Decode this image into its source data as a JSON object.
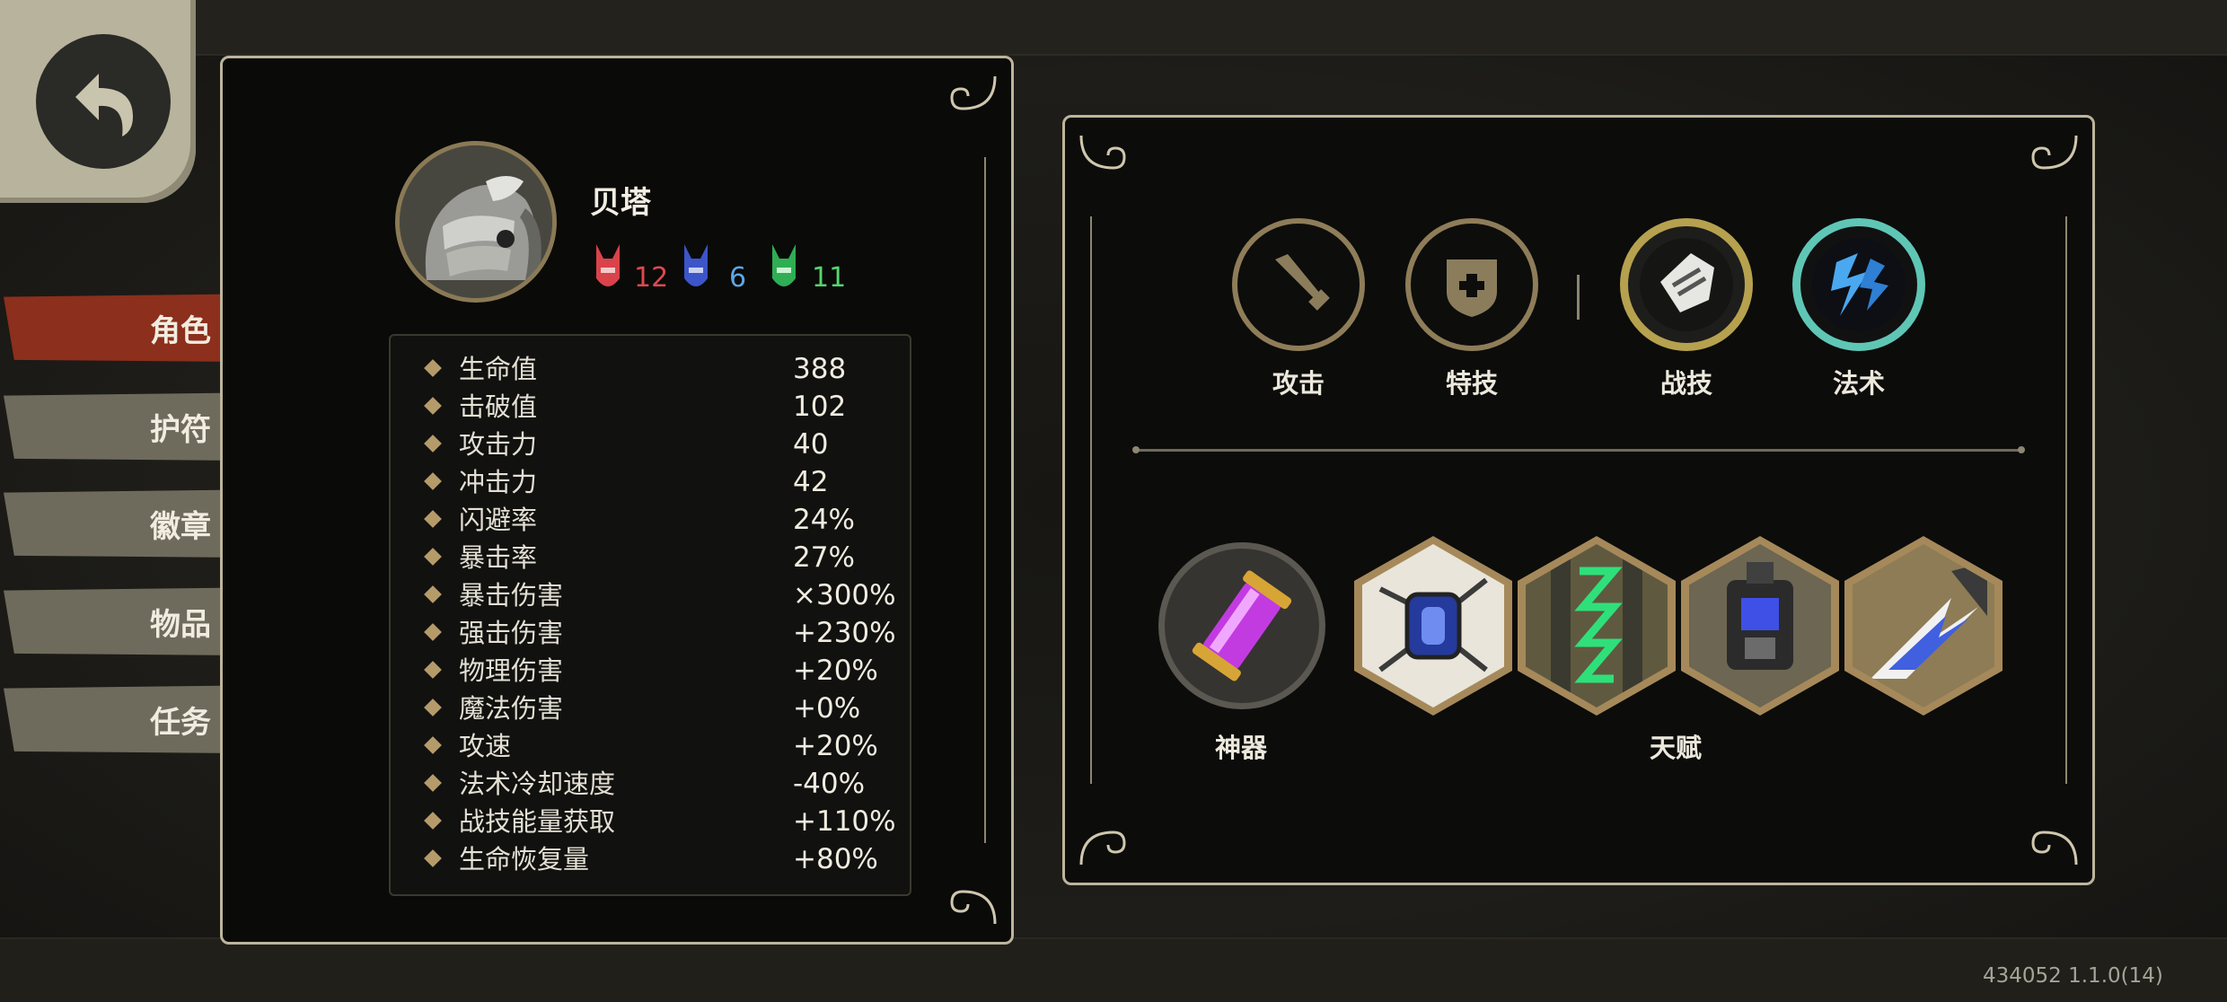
{
  "character": {
    "name": "贝塔",
    "resources": [
      {
        "icon": "red-mask-icon",
        "value": "12",
        "color": "#e0484d"
      },
      {
        "icon": "blue-mask-icon",
        "value": "6",
        "color": "#5fa6e6"
      },
      {
        "icon": "green-mask-icon",
        "value": "11",
        "color": "#55d66a"
      }
    ]
  },
  "tabs": [
    {
      "label": "角色",
      "active": true
    },
    {
      "label": "护符",
      "active": false
    },
    {
      "label": "徽章",
      "active": false
    },
    {
      "label": "物品",
      "active": false
    },
    {
      "label": "任务",
      "active": false
    }
  ],
  "stats": [
    {
      "label": "生命值",
      "value": "388"
    },
    {
      "label": "击破值",
      "value": "102"
    },
    {
      "label": "攻击力",
      "value": "40"
    },
    {
      "label": "冲击力",
      "value": "42"
    },
    {
      "label": "闪避率",
      "value": "24%"
    },
    {
      "label": "暴击率",
      "value": "27%"
    },
    {
      "label": "暴击伤害",
      "value": "×300%"
    },
    {
      "label": "强击伤害",
      "value": "+230%"
    },
    {
      "label": "物理伤害",
      "value": "+20%"
    },
    {
      "label": "魔法伤害",
      "value": "+0%"
    },
    {
      "label": "攻速",
      "value": "+20%"
    },
    {
      "label": "法术冷却速度",
      "value": "-40%"
    },
    {
      "label": "战技能量获取",
      "value": "+110%"
    },
    {
      "label": "生命恢复量",
      "value": "+80%"
    }
  ],
  "skills": [
    {
      "label": "攻击",
      "icon": "sword-icon"
    },
    {
      "label": "特技",
      "icon": "shield-icon"
    },
    {
      "label": "战技",
      "icon": "gauntlet-icon"
    },
    {
      "label": "法术",
      "icon": "lightning-icon"
    }
  ],
  "artifact": {
    "label": "神器",
    "icon": "purple-canister-icon"
  },
  "talents": {
    "label": "天赋",
    "icons": [
      "blue-capsule-icon",
      "green-rune-icon",
      "blue-cell-device-icon",
      "blue-strike-icon"
    ]
  },
  "version": "434052 1.1.0(14)",
  "colors": {
    "panel_border": "#bdb59b",
    "active_tab": "#8c2f1d",
    "inactive_tab": "#6f6b5c",
    "accent_gold": "#b59b6a"
  }
}
